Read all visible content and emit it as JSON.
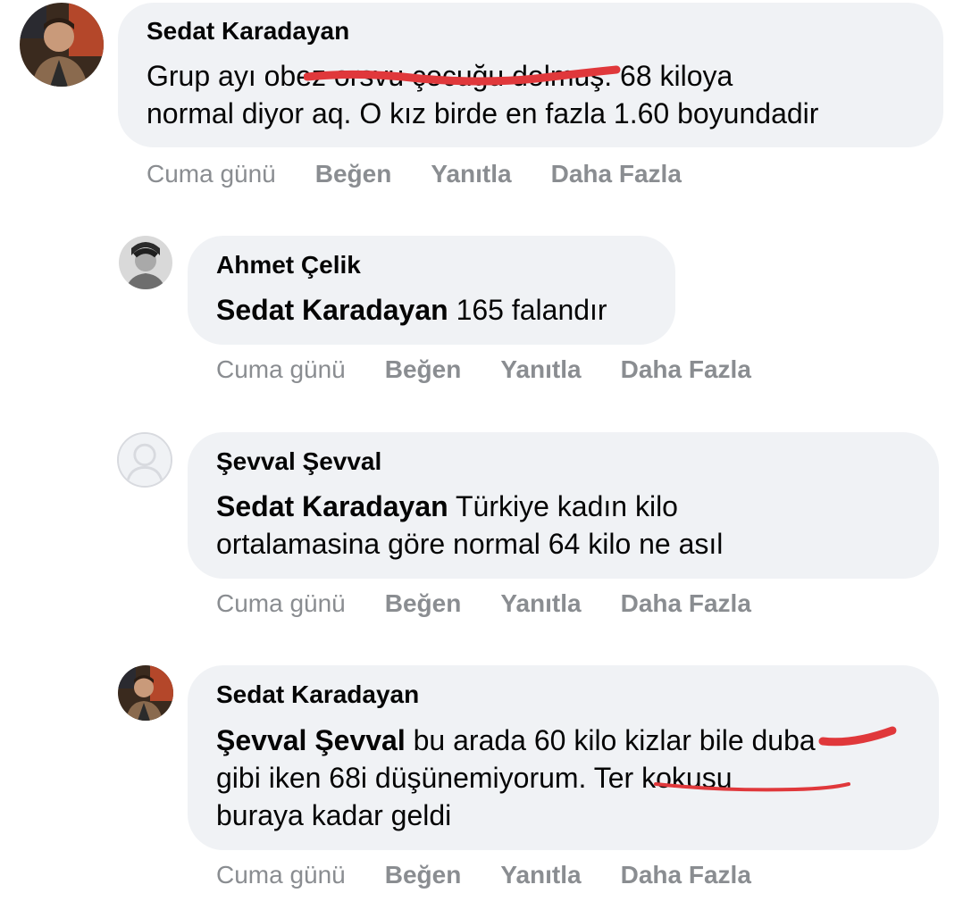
{
  "comments": [
    {
      "author": "Sedat Karadayan",
      "text_lines": [
        "Grup ayı obez orsvu çocuğu dolmuş. 68 kiloya",
        "normal diyor aq. O kız birde en fazla 1.60 boyundadir"
      ],
      "time": "Cuma günü",
      "like": "Beğen",
      "reply": "Yanıtla",
      "more": "Daha Fazla"
    },
    {
      "author": "Ahmet Çelik",
      "mention": "Sedat Karadayan",
      "text_rest": " 165 falandır",
      "time": "Cuma günü",
      "like": "Beğen",
      "reply": "Yanıtla",
      "more": "Daha Fazla"
    },
    {
      "author": "Şevval Şevval",
      "mention": "Sedat Karadayan",
      "text_rest_1": " Türkiye kadın kilo",
      "text_line_2": "ortalamasina göre normal 64 kilo ne asıl",
      "time": "Cuma günü",
      "like": "Beğen",
      "reply": "Yanıtla",
      "more": "Daha Fazla"
    },
    {
      "author": "Sedat Karadayan",
      "mention": "Şevval Şevval",
      "text_rest_1": " bu arada 60 kilo kizlar bile duba",
      "text_line_2": "gibi iken 68i düşünemiyorum. Ter kokusu",
      "text_line_3": "buraya kadar geldi",
      "time": "Cuma günü",
      "like": "Beğen",
      "reply": "Yanıtla",
      "more": "Daha Fazla"
    }
  ],
  "colors": {
    "bubble": "#f0f2f5",
    "meta": "#8a8d91",
    "annotation": "#e0383b"
  }
}
